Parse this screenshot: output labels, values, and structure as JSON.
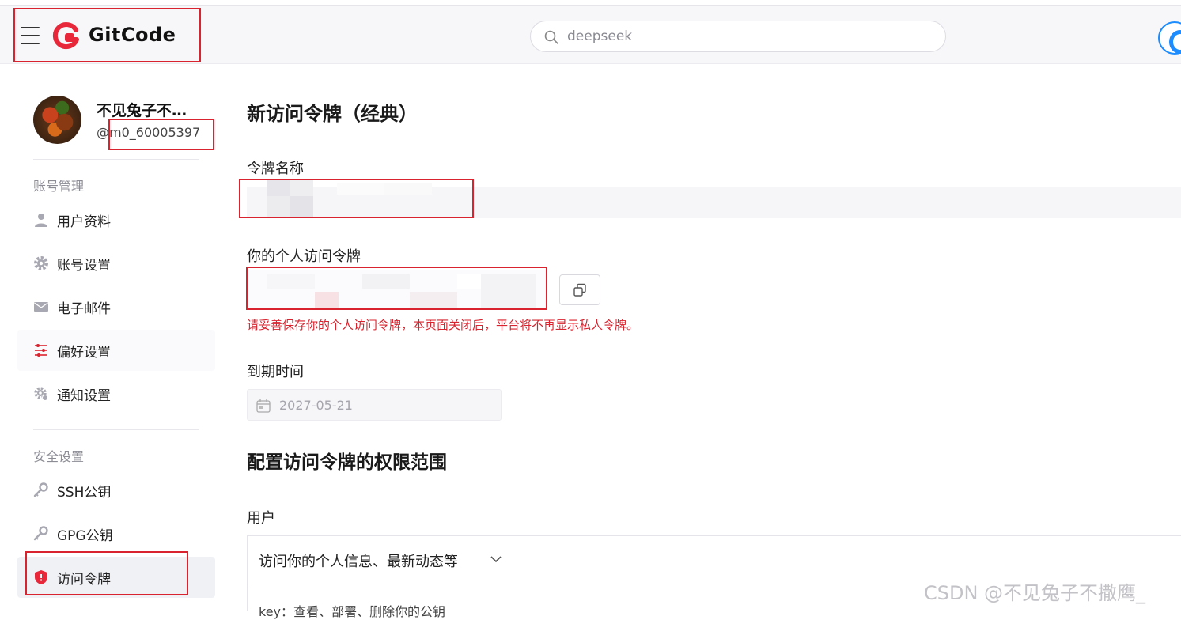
{
  "header": {
    "logo_text": "GitCode",
    "search_placeholder": "deepseek"
  },
  "profile": {
    "name": "不见兔子不…",
    "id_prefix": "@",
    "id": "m0_60005397"
  },
  "sidebar": {
    "section_account": "账号管理",
    "section_security": "安全设置",
    "items": [
      {
        "label": "用户资料",
        "icon": "user-icon"
      },
      {
        "label": "账号设置",
        "icon": "gear-icon"
      },
      {
        "label": "电子邮件",
        "icon": "mail-icon"
      },
      {
        "label": "偏好设置",
        "icon": "sliders-icon"
      },
      {
        "label": "通知设置",
        "icon": "notification-gear-icon"
      },
      {
        "label": "SSH公钥",
        "icon": "key-icon"
      },
      {
        "label": "GPG公钥",
        "icon": "key-icon"
      },
      {
        "label": "访问令牌",
        "icon": "shield-icon"
      }
    ]
  },
  "main": {
    "title": "新访问令牌（经典）",
    "token_name_label": "令牌名称",
    "personal_token_label": "你的个人访问令牌",
    "warning": "请妥善保存你的个人访问令牌，本页面关闭后，平台将不再显示私人令牌。",
    "expiry_label": "到期时间",
    "expiry_value": "2027-05-21",
    "scope_title": "配置访问令牌的权限范围",
    "user_section_label": "用户",
    "permission_group": "访问你的个人信息、最新动态等",
    "permission_detail": "key：查看、部署、删除你的公钥"
  },
  "watermark": "CSDN @不见兔子不撒鹰_",
  "colors": {
    "brand": "#e8283a",
    "warning": "#d9232e",
    "annotation_box": "#d9232e",
    "accent_blue": "#1c8cff"
  }
}
